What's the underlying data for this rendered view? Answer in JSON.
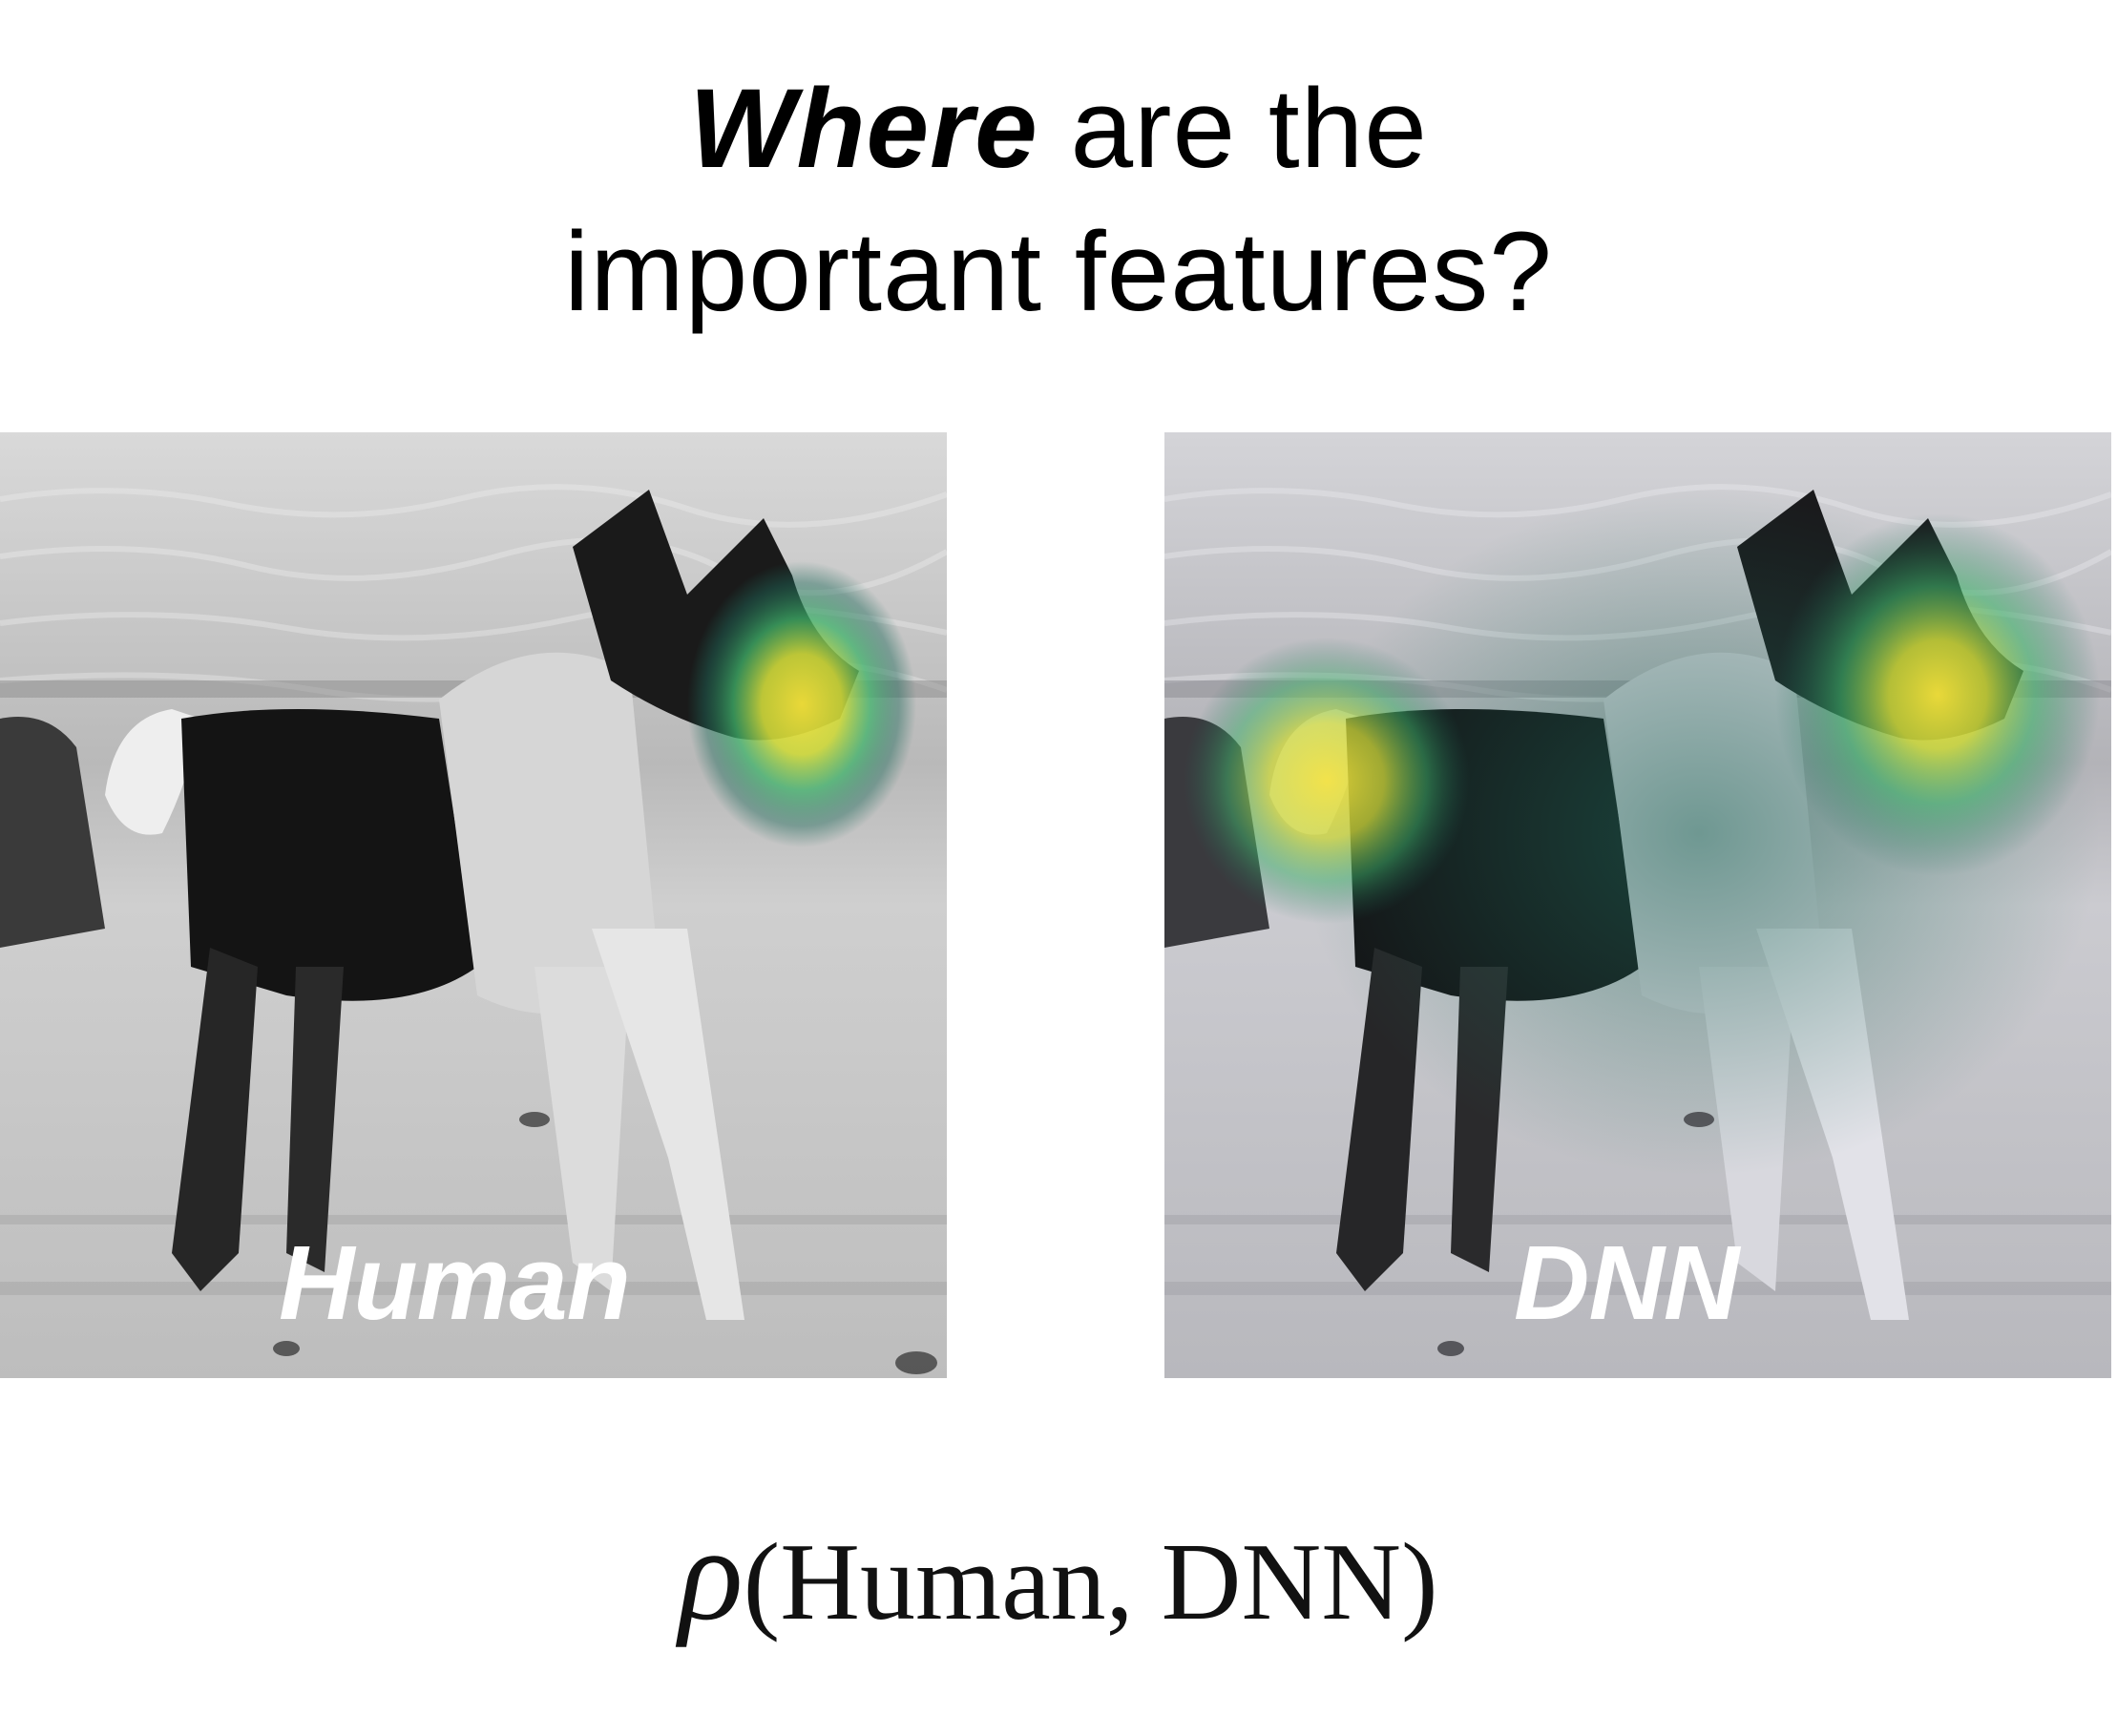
{
  "title": {
    "line1_emphasis": "Where",
    "line1_rest": " are the",
    "line2": "important features?"
  },
  "panels": [
    {
      "label": "Human",
      "icon": "dog-photo-with-human-heatmap"
    },
    {
      "label": "DNN",
      "icon": "dog-photo-with-dnn-heatmap"
    }
  ],
  "formula": {
    "symbol": "ρ",
    "args": "(Human, DNN)"
  },
  "colors": {
    "heat_hot": "#f4e23a",
    "heat_mid": "#3fb36a",
    "heat_cool": "#1f6a5a",
    "background": "#ffffff"
  }
}
